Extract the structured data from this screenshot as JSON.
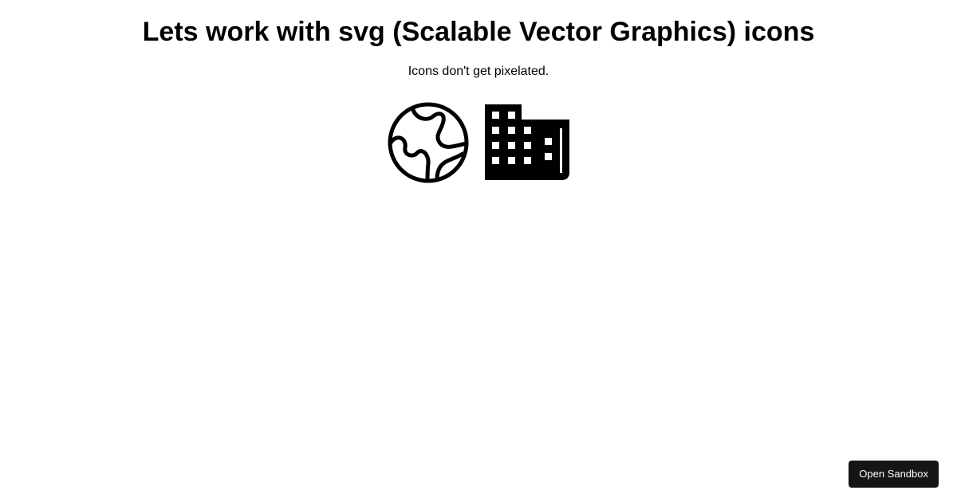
{
  "header": {
    "title": "Lets work with svg (Scalable Vector Graphics) icons",
    "subtitle": "Icons don't get pixelated."
  },
  "icons": [
    {
      "name": "globe-icon",
      "color": "#000000"
    },
    {
      "name": "building-icon",
      "color": "#000000"
    }
  ],
  "sandbox": {
    "label": "Open Sandbox",
    "background": "#151515",
    "text_color": "#ffffff"
  }
}
